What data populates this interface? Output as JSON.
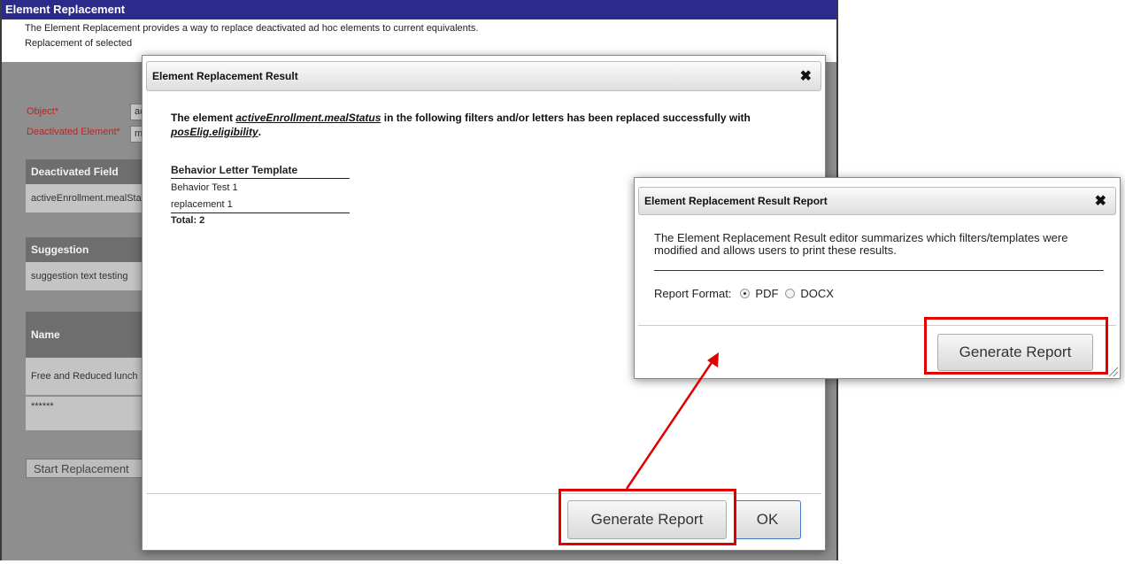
{
  "background": {
    "title": "Element Replacement",
    "description_line1": "The Element Replacement provides a way to replace deactivated ad hoc elements to current equivalents.",
    "description_line2": "Replacement of selected",
    "object_label": "Object*",
    "object_value": "ac",
    "deactivated_element_label": "Deactivated Element*",
    "deactivated_element_value": "m",
    "deactivated_field_header": "Deactivated Field",
    "deactivated_field_value": "activeEnrollment.mealSta",
    "suggestion_header": "Suggestion",
    "suggestion_value": "suggestion text testing",
    "name_header": "Name",
    "name_row1": "Free and Reduced lunch",
    "name_row2": "******",
    "start_button": "Start Replacement"
  },
  "result_dialog": {
    "title": "Element Replacement Result",
    "close_glyph": "✖",
    "message_prefix": "The element ",
    "old_element": "activeEnrollment.mealStatus",
    "message_middle": " in the following filters and/or letters has been replaced successfully with ",
    "new_element": "posElig.eligibility",
    "message_suffix": ".",
    "table_header": "Behavior Letter Template",
    "rows": [
      "Behavior Test 1",
      "replacement 1"
    ],
    "total": "Total: 2",
    "generate_button": "Generate Report",
    "ok_button": "OK"
  },
  "report_dialog": {
    "title": "Element Replacement Result Report",
    "close_glyph": "✖",
    "description": "The Element Replacement Result editor summarizes which filters/templates were modified and allows users to print these results.",
    "format_label": "Report Format:",
    "formats": [
      {
        "label": "PDF",
        "selected": true
      },
      {
        "label": "DOCX",
        "selected": false
      }
    ],
    "generate_button": "Generate Report"
  },
  "colors": {
    "title_bar_bg": "#2b2b8c",
    "highlight": "#e00000",
    "required_label": "#c42020"
  }
}
